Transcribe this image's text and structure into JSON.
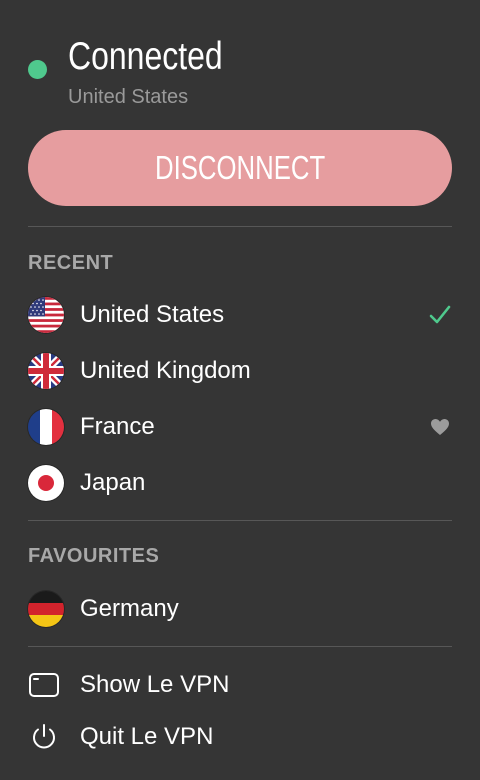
{
  "status": {
    "title": "Connected",
    "location": "United States",
    "indicator_color": "#4fc98d"
  },
  "disconnect_label": "DISCONNECT",
  "recent": {
    "heading": "RECENT",
    "items": [
      {
        "label": "United States",
        "flag": "us-flag-icon",
        "marker": "checkmark-icon"
      },
      {
        "label": "United Kingdom",
        "flag": "uk-flag-icon",
        "marker": ""
      },
      {
        "label": "France",
        "flag": "france-flag-icon",
        "marker": "heart-icon"
      },
      {
        "label": "Japan",
        "flag": "japan-flag-icon",
        "marker": ""
      }
    ]
  },
  "favourites": {
    "heading": "FAVOURITES",
    "items": [
      {
        "label": "Germany",
        "flag": "germany-flag-icon"
      }
    ]
  },
  "menu": {
    "show_label": "Show Le VPN",
    "show_icon": "window-icon",
    "quit_label": "Quit Le VPN",
    "quit_icon": "power-icon"
  },
  "colors": {
    "background": "#353535",
    "accent_connected": "#4fc98d",
    "disconnect_button": "#e69d9f",
    "muted_text": "#9a9a9a"
  }
}
